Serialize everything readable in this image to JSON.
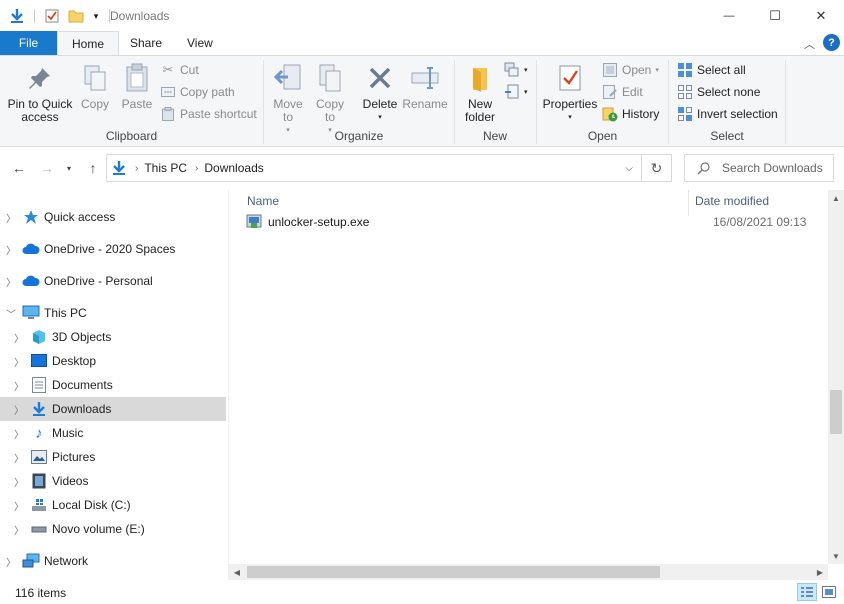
{
  "window": {
    "title": "Downloads",
    "minimize_glyph": "—",
    "maximize_glyph": "☐",
    "close_glyph": "✕"
  },
  "tabs": [
    {
      "label": "File"
    },
    {
      "label": "Home"
    },
    {
      "label": "Share"
    },
    {
      "label": "View"
    }
  ],
  "ribbon": {
    "clipboard": {
      "label": "Clipboard",
      "pin": "Pin to Quick access",
      "copy": "Copy",
      "paste": "Paste",
      "cut": "Cut",
      "copy_path": "Copy path",
      "paste_shortcut": "Paste shortcut"
    },
    "organize": {
      "label": "Organize",
      "move_to": "Move to",
      "copy_to": "Copy to",
      "delete": "Delete",
      "rename": "Rename"
    },
    "new": {
      "label": "New",
      "new_folder": "New folder"
    },
    "open": {
      "label": "Open",
      "properties": "Properties",
      "open": "Open",
      "edit": "Edit",
      "history": "History"
    },
    "select": {
      "label": "Select",
      "select_all": "Select all",
      "select_none": "Select none",
      "invert": "Invert selection"
    }
  },
  "address": {
    "crumbs": [
      "This PC",
      "Downloads"
    ],
    "search_placeholder": "Search Downloads"
  },
  "navpane": {
    "items": [
      {
        "label": "Quick access"
      },
      {
        "label": "OneDrive - 2020 Spaces"
      },
      {
        "label": "OneDrive - Personal"
      },
      {
        "label": "This PC"
      },
      {
        "label": "3D Objects"
      },
      {
        "label": "Desktop"
      },
      {
        "label": "Documents"
      },
      {
        "label": "Downloads"
      },
      {
        "label": "Music"
      },
      {
        "label": "Pictures"
      },
      {
        "label": "Videos"
      },
      {
        "label": "Local Disk (C:)"
      },
      {
        "label": "Novo volume (E:)"
      },
      {
        "label": "Network"
      }
    ]
  },
  "content": {
    "columns": {
      "name": "Name",
      "date": "Date modified"
    },
    "files": [
      {
        "name": "unlocker-setup.exe",
        "date": "16/08/2021 09:13"
      }
    ]
  },
  "status": {
    "count": "116 items"
  },
  "colors": {
    "accent": "#1979ca",
    "selected_bg": "#d9d9d9",
    "ribbon_bg": "#f5f6f7"
  }
}
